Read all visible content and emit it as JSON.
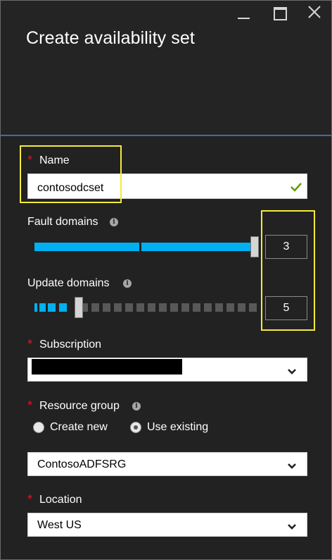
{
  "window": {
    "title": "Create availability set",
    "icons": {
      "minimize": "minimize-icon",
      "maximize": "maximize-icon",
      "close": "close-icon"
    }
  },
  "name": {
    "label": "Name",
    "required_marker": "*",
    "value": "contosodcset",
    "valid_icon": "checkmark-icon"
  },
  "fault_domains": {
    "label": "Fault domains",
    "info_icon": "i",
    "value": "3",
    "min": 1,
    "max": 3
  },
  "update_domains": {
    "label": "Update domains",
    "info_icon": "i",
    "value": "5",
    "min": 1,
    "max": 20
  },
  "subscription": {
    "label": "Subscription",
    "required_marker": "*",
    "value_redacted": true
  },
  "resource_group": {
    "label": "Resource group",
    "required_marker": "*",
    "info_icon": "i",
    "options": [
      {
        "label": "Create new",
        "selected": false
      },
      {
        "label": "Use existing",
        "selected": true
      }
    ],
    "value": "ContosoADFSRG"
  },
  "location": {
    "label": "Location",
    "required_marker": "*",
    "value": "West US"
  },
  "colors": {
    "accent": "#00b0f0",
    "highlight": "#f5ea3b",
    "required": "#e81123",
    "valid": "#5ea200",
    "background": "#222222"
  }
}
